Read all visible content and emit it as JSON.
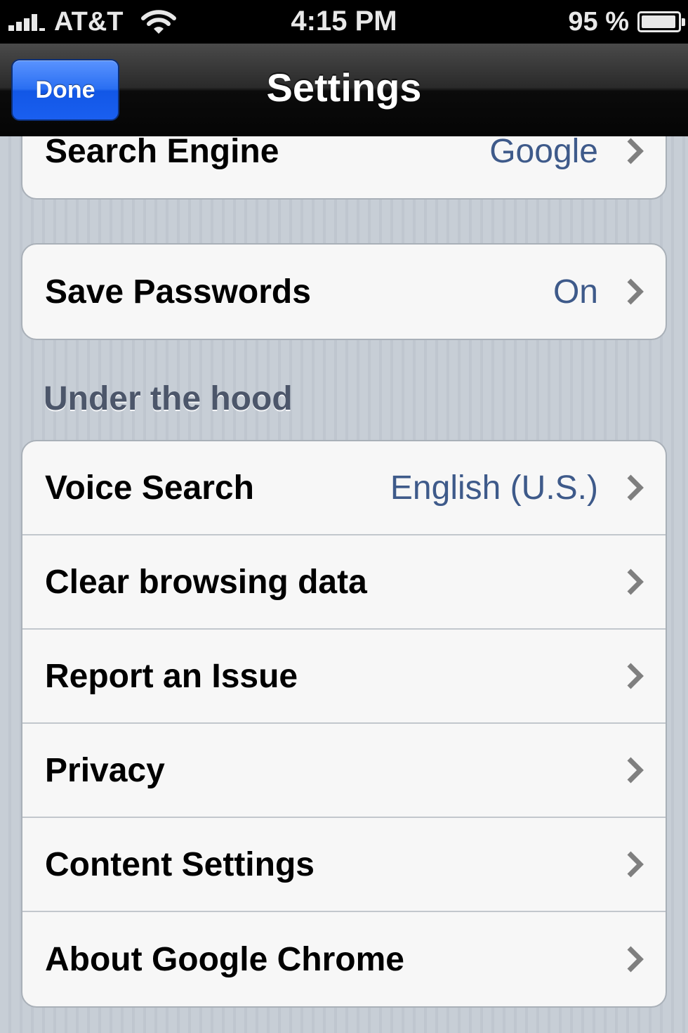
{
  "status_bar": {
    "carrier": "AT&T",
    "time": "4:15 PM",
    "battery_percent": "95 %",
    "battery_level": 0.95
  },
  "nav_bar": {
    "done_label": "Done",
    "title": "Settings"
  },
  "groups": {
    "search": {
      "rows": [
        {
          "label": "Search Engine",
          "value": "Google"
        }
      ]
    },
    "passwords": {
      "rows": [
        {
          "label": "Save Passwords",
          "value": "On"
        }
      ]
    },
    "under_the_hood": {
      "header": "Under the hood",
      "rows": [
        {
          "label": "Voice Search",
          "value": "English (U.S.)"
        },
        {
          "label": "Clear browsing data"
        },
        {
          "label": "Report an Issue"
        },
        {
          "label": "Privacy"
        },
        {
          "label": "Content Settings"
        },
        {
          "label": "About Google Chrome"
        }
      ]
    }
  },
  "colors": {
    "value_text": "#3e5a8a",
    "done_button": "#1a5ff0",
    "nav_bar": "#0b0b0b"
  },
  "icons": [
    "signal-strength-icon",
    "wifi-icon",
    "battery-icon",
    "chevron-right-icon"
  ]
}
